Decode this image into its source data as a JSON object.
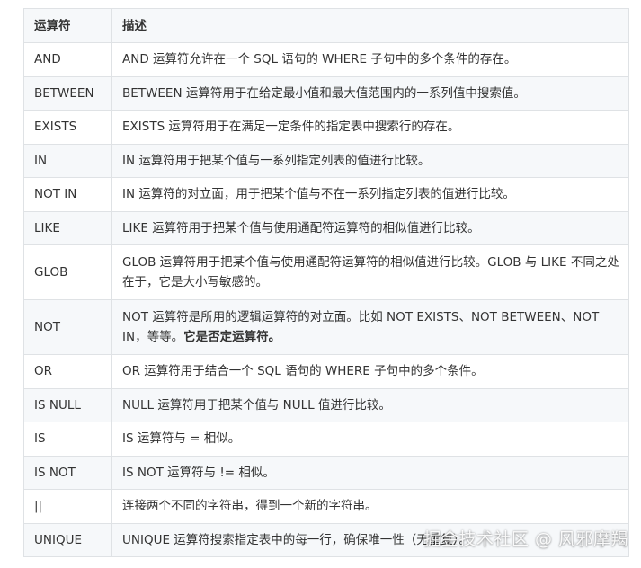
{
  "table": {
    "headers": [
      "运算符",
      "描述"
    ],
    "rows": [
      {
        "op": "AND",
        "desc": "AND 运算符允许在一个 SQL 语句的 WHERE 子句中的多个条件的存在。",
        "desc_bold": ""
      },
      {
        "op": "BETWEEN",
        "desc": "BETWEEN 运算符用于在给定最小值和最大值范围内的一系列值中搜索值。",
        "desc_bold": ""
      },
      {
        "op": "EXISTS",
        "desc": "EXISTS 运算符用于在满足一定条件的指定表中搜索行的存在。",
        "desc_bold": ""
      },
      {
        "op": "IN",
        "desc": "IN 运算符用于把某个值与一系列指定列表的值进行比较。",
        "desc_bold": ""
      },
      {
        "op": "NOT IN",
        "desc": "IN 运算符的对立面，用于把某个值与不在一系列指定列表的值进行比较。",
        "desc_bold": ""
      },
      {
        "op": "LIKE",
        "desc": "LIKE 运算符用于把某个值与使用通配符运算符的相似值进行比较。",
        "desc_bold": ""
      },
      {
        "op": "GLOB",
        "desc": "GLOB 运算符用于把某个值与使用通配符运算符的相似值进行比较。GLOB 与 LIKE 不同之处在于，它是大小写敏感的。",
        "desc_bold": ""
      },
      {
        "op": "NOT",
        "desc": "NOT 运算符是所用的逻辑运算符的对立面。比如 NOT EXISTS、NOT BETWEEN、NOT IN，等等。",
        "desc_bold": "它是否定运算符。"
      },
      {
        "op": "OR",
        "desc": "OR 运算符用于结合一个 SQL 语句的 WHERE 子句中的多个条件。",
        "desc_bold": ""
      },
      {
        "op": "IS NULL",
        "desc": "NULL 运算符用于把某个值与 NULL 值进行比较。",
        "desc_bold": ""
      },
      {
        "op": "IS",
        "desc": "IS 运算符与 = 相似。",
        "desc_bold": ""
      },
      {
        "op": "IS NOT",
        "desc": "IS NOT 运算符与 != 相似。",
        "desc_bold": ""
      },
      {
        "op": "||",
        "desc": "连接两个不同的字符串，得到一个新的字符串。",
        "desc_bold": ""
      },
      {
        "op": "UNIQUE",
        "desc": "UNIQUE 运算符搜索指定表中的每一行，确保唯一性（无重复）。",
        "desc_bold": ""
      }
    ]
  },
  "watermark": "掘金技术社区 @ 风邪摩羯"
}
